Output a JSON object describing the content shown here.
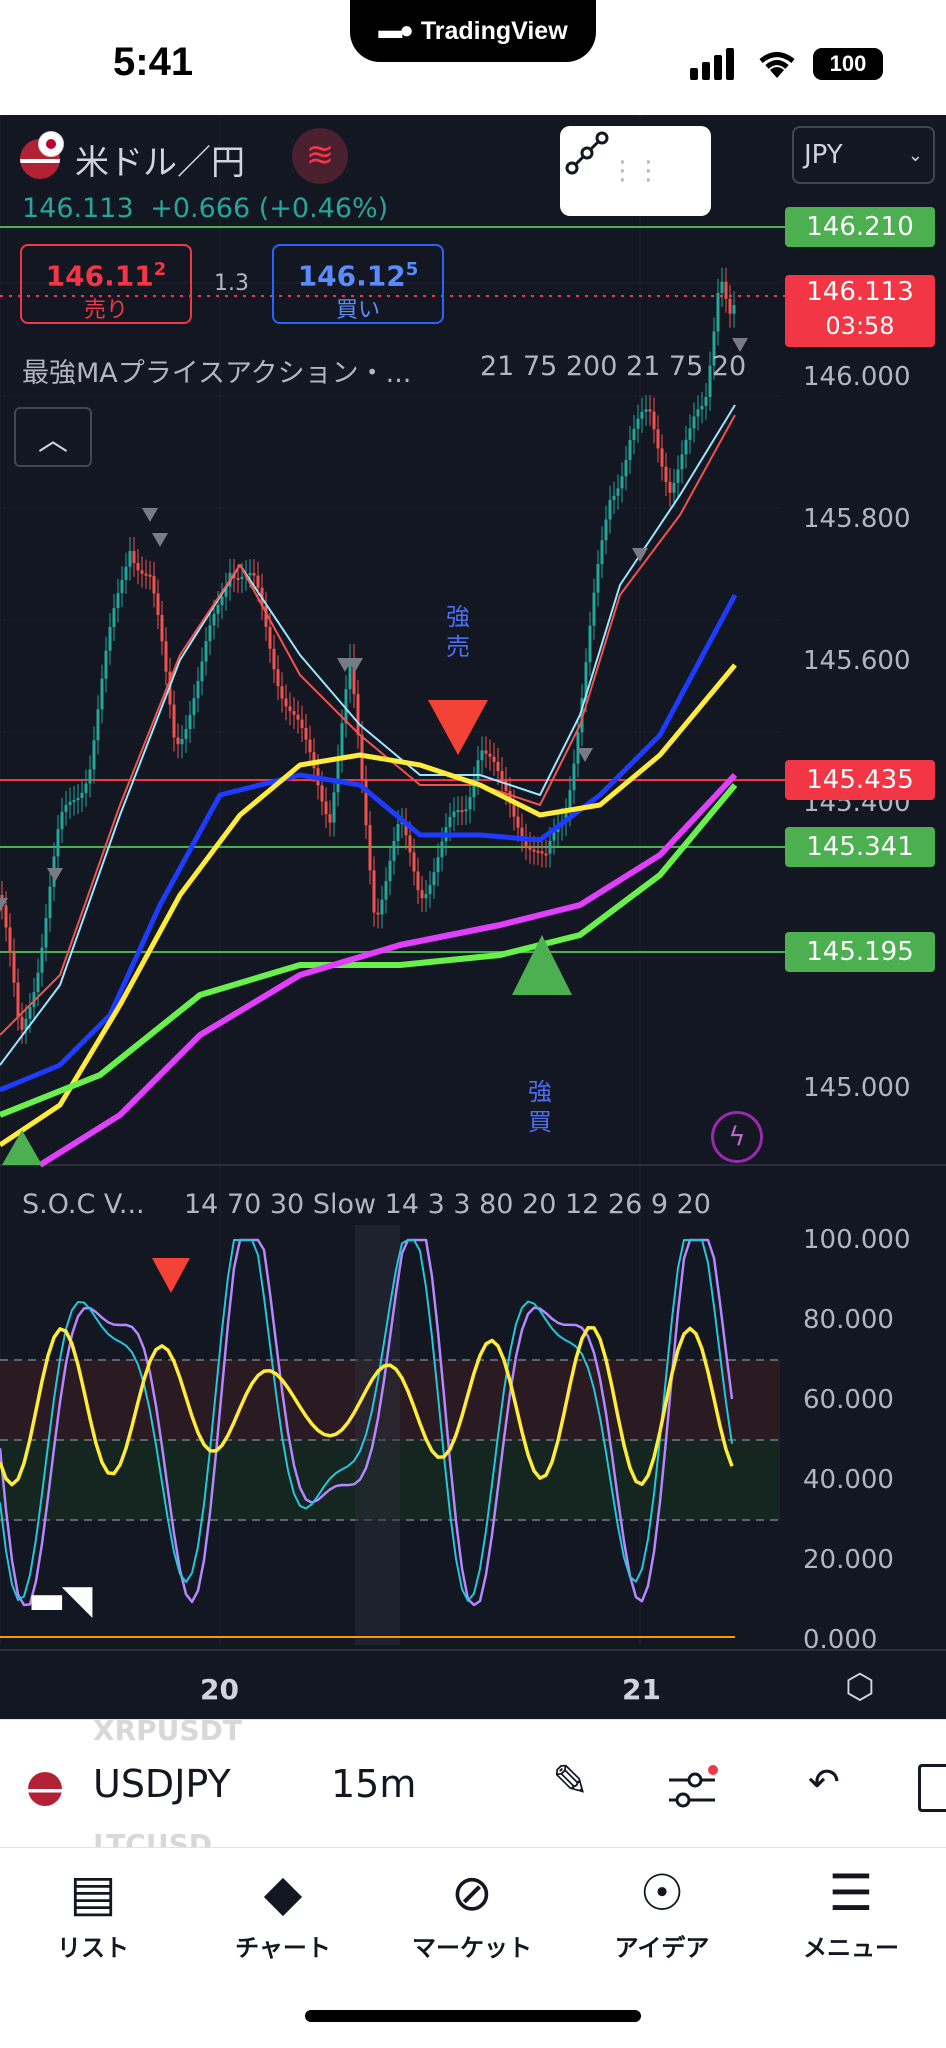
{
  "status_bar": {
    "time": "5:41",
    "app_name": "TradingView",
    "battery": "100"
  },
  "header": {
    "symbol_title": "米ドル／円",
    "price": "146.113",
    "change": "+0.666 (+0.46%)",
    "currency_select": "JPY",
    "bid": {
      "price_main": "146.11",
      "price_sup": "2",
      "label": "売り"
    },
    "spread": "1.3",
    "ask": {
      "price_main": "146.12",
      "price_sup": "5",
      "label": "買い"
    }
  },
  "indicator1": {
    "name": "最強MAプライスアクション・...",
    "params": "21 75 200 21 75 20"
  },
  "indicator2": {
    "name": "S.O.C V...",
    "params": "14 70 30 Slow 14 3 3 80 20 12 26 9 20"
  },
  "annotations": {
    "sell": [
      "強",
      "売"
    ],
    "buy": [
      "強",
      "買"
    ]
  },
  "price_axis": [
    "146.000",
    "145.800",
    "145.600",
    "145.400",
    "145.000"
  ],
  "price_labels": [
    {
      "value": "146.210",
      "color": "#4caf50"
    },
    {
      "value": "146.113",
      "sub": "03:58",
      "color": "#f23645"
    },
    {
      "value": "145.435",
      "color": "#f23645"
    },
    {
      "value": "145.341",
      "color": "#4caf50"
    },
    {
      "value": "145.195",
      "color": "#4caf50"
    }
  ],
  "osc_axis": [
    "100.000",
    "80.000",
    "60.000",
    "40.000",
    "20.000",
    "0.000"
  ],
  "x_axis": [
    "20",
    "21"
  ],
  "toolbar": {
    "symbol": "USDJPY",
    "interval": "15m",
    "ghost_top": "XRPUSDT",
    "ghost_bottom": "LTCUSD"
  },
  "tabs": [
    {
      "label": "リスト",
      "icon": "list-icon"
    },
    {
      "label": "チャート",
      "icon": "chart-icon"
    },
    {
      "label": "マーケット",
      "icon": "compass-icon"
    },
    {
      "label": "アイデア",
      "icon": "lightbulb-icon"
    },
    {
      "label": "メニュー",
      "icon": "menu-icon"
    }
  ],
  "colors": {
    "background": "#131722",
    "up": "#26a69a",
    "down": "#ef5350",
    "ma_yellow": "#ffeb3b",
    "ma_blue": "#1e3cff",
    "ma_magenta": "#e040fb",
    "ma_green": "#69f04d"
  }
}
